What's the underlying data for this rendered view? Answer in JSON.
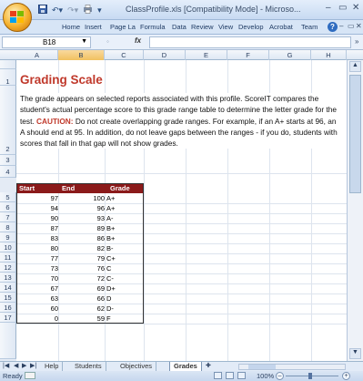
{
  "titlebar": {
    "title": "ClassProfile.xls  [Compatibility Mode] - Microso...",
    "minimize": "–",
    "maximize": "▭",
    "close": "✕"
  },
  "ribbon": {
    "tabs": [
      "Home",
      "Insert",
      "Page La",
      "Formula",
      "Data",
      "Review",
      "View",
      "Develop",
      "Acrobat",
      "Team"
    ],
    "help": "?",
    "minimize": "–",
    "restore": "▭",
    "close": "✕"
  },
  "formula_bar": {
    "name_box": "B18",
    "fx": "fx",
    "value": ""
  },
  "columns": [
    "A",
    "B",
    "C",
    "D",
    "E",
    "F",
    "G",
    "H"
  ],
  "selected_column": "B",
  "rows": [
    "1",
    "2",
    "3",
    "4",
    "5",
    "6",
    "7",
    "8",
    "9",
    "10",
    "11",
    "12",
    "13",
    "14",
    "15",
    "16",
    "17"
  ],
  "sheet": {
    "title": "Grading Scale",
    "description": "The grade appears on selected reports associated with this profile. ScoreIT compares the student's actual percentage score to this grade range table to determine the letter grade for the test.",
    "caution_label": "CAUTION:",
    "caution_text": " Do not create overlapping grade ranges. For example, if an A+ starts at 96, an A should end at 95. In addition, do not leave gaps between the ranges - if you do, students with scores that fall in that gap will not show grades.",
    "table": {
      "headers": [
        "Start",
        "End",
        "Grade"
      ],
      "rows": [
        [
          "97",
          "100",
          "A+"
        ],
        [
          "94",
          "96",
          "A+"
        ],
        [
          "90",
          "93",
          "A-"
        ],
        [
          "87",
          "89",
          "B+"
        ],
        [
          "83",
          "86",
          "B+"
        ],
        [
          "80",
          "82",
          "B-"
        ],
        [
          "77",
          "79",
          "C+"
        ],
        [
          "73",
          "76",
          "C"
        ],
        [
          "70",
          "72",
          "C-"
        ],
        [
          "67",
          "69",
          "D+"
        ],
        [
          "63",
          "66",
          "D"
        ],
        [
          "60",
          "62",
          "D-"
        ],
        [
          "0",
          "59",
          "F"
        ]
      ]
    }
  },
  "sheet_tabs": {
    "tabs": [
      "Help",
      "Students",
      "Objectives",
      "Grades"
    ],
    "active": "Grades"
  },
  "statusbar": {
    "status": "Ready",
    "zoom": "100%"
  }
}
